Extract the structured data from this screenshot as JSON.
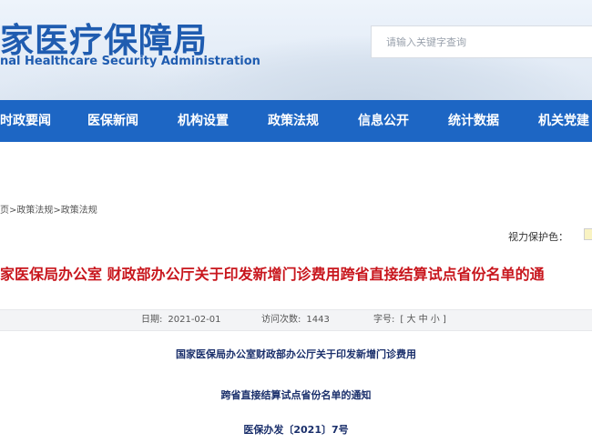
{
  "header": {
    "title": "家医疗保障局",
    "subtitle": "nal Healthcare Security Administration",
    "search_placeholder": "请输入关键字查询"
  },
  "nav": {
    "items": [
      {
        "label": "时政要闻"
      },
      {
        "label": "医保新闻"
      },
      {
        "label": "机构设置"
      },
      {
        "label": "政策法规"
      },
      {
        "label": "信息公开"
      },
      {
        "label": "统计数据"
      },
      {
        "label": "机关党建"
      }
    ]
  },
  "breadcrumb": "页>政策法规>政策法规",
  "eye_protection": {
    "label": "视力保护色：",
    "color": "#f9f3c2"
  },
  "article": {
    "title": "家医保局办公室 财政部办公厅关于印发新增门诊费用跨省直接结算试点省份名单的通",
    "meta": {
      "date_label": "日期:",
      "date": "2021-02-01",
      "views_label": "访问次数:",
      "views": "1443",
      "font_size_label": "字号:",
      "font_size_options": "[ 大 中 小 ]"
    },
    "body_lines": [
      "国家医保局办公室财政部办公厅关于印发新增门诊费用",
      "跨省直接结算试点省份名单的通知",
      "医保办发〔2021〕7号"
    ]
  },
  "colors": {
    "brand_blue": "#1d66c4",
    "title_red": "#c8161d"
  }
}
